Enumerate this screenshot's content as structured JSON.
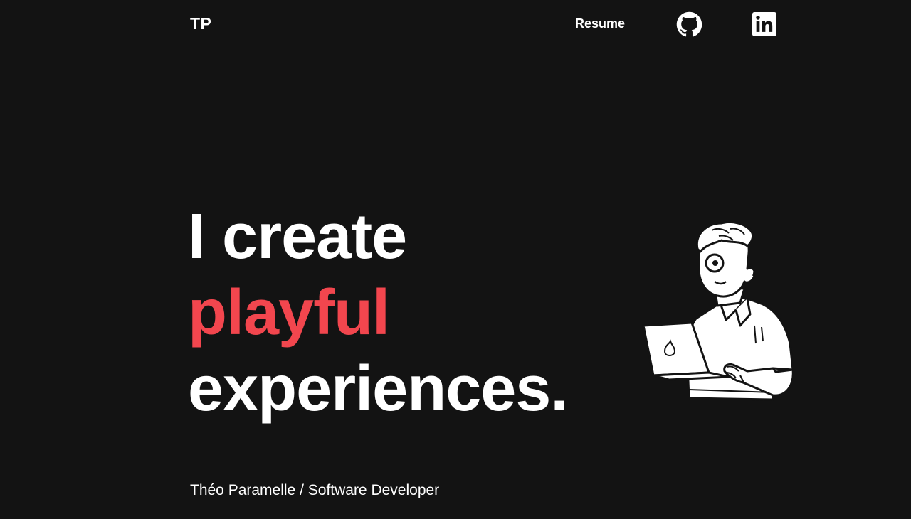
{
  "nav": {
    "logo": "TP",
    "resume_label": "Resume",
    "github_icon": "github-icon",
    "linkedin_icon": "linkedin-icon"
  },
  "hero": {
    "line1": "I create",
    "line2": "playful",
    "line3": "experiences.",
    "accent_color": "#f2464e",
    "illustration": "developer-with-laptop-illustration"
  },
  "footer": {
    "subtitle": "Théo Paramelle / Software Developer"
  },
  "colors": {
    "background": "#131313",
    "text": "#ffffff",
    "accent": "#f2464e"
  }
}
